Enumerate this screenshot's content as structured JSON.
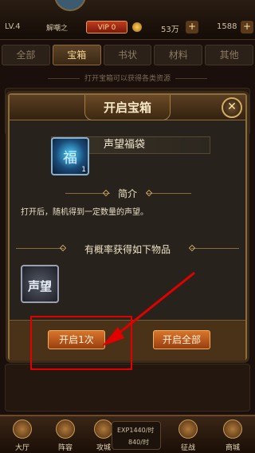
{
  "header": {
    "level": "LV.4",
    "player_name": "解嘲之",
    "vip": "VIP 0",
    "gold": "53万",
    "diamonds": "1588",
    "plus": "+"
  },
  "tabs": [
    {
      "label": "全部"
    },
    {
      "label": "宝箱"
    },
    {
      "label": "书状"
    },
    {
      "label": "材料"
    },
    {
      "label": "其他"
    }
  ],
  "hint": "打开宝箱可以获得各类资源",
  "modal": {
    "title": "开启宝箱",
    "close": "✕",
    "item_name": "声望福袋",
    "item_count": "1",
    "item_glyph": "福",
    "intro_label": "简介",
    "description": "打开后，随机得到一定数量的声望。",
    "rewards_label": "有概率获得如下物品",
    "reward_text": "声望",
    "open_once": "开启1次",
    "open_all": "开启全部"
  },
  "bottom_nav": {
    "items": [
      {
        "label": "大厅"
      },
      {
        "label": "阵容"
      },
      {
        "label": "攻城"
      },
      {
        "label": "征战"
      },
      {
        "label": "商城"
      }
    ],
    "exp_rate": "EXP1440/时",
    "gold_rate": "840/时"
  },
  "colors": {
    "accent": "#8d6c3c",
    "button": "#d8752c",
    "highlight": "#e00000"
  }
}
